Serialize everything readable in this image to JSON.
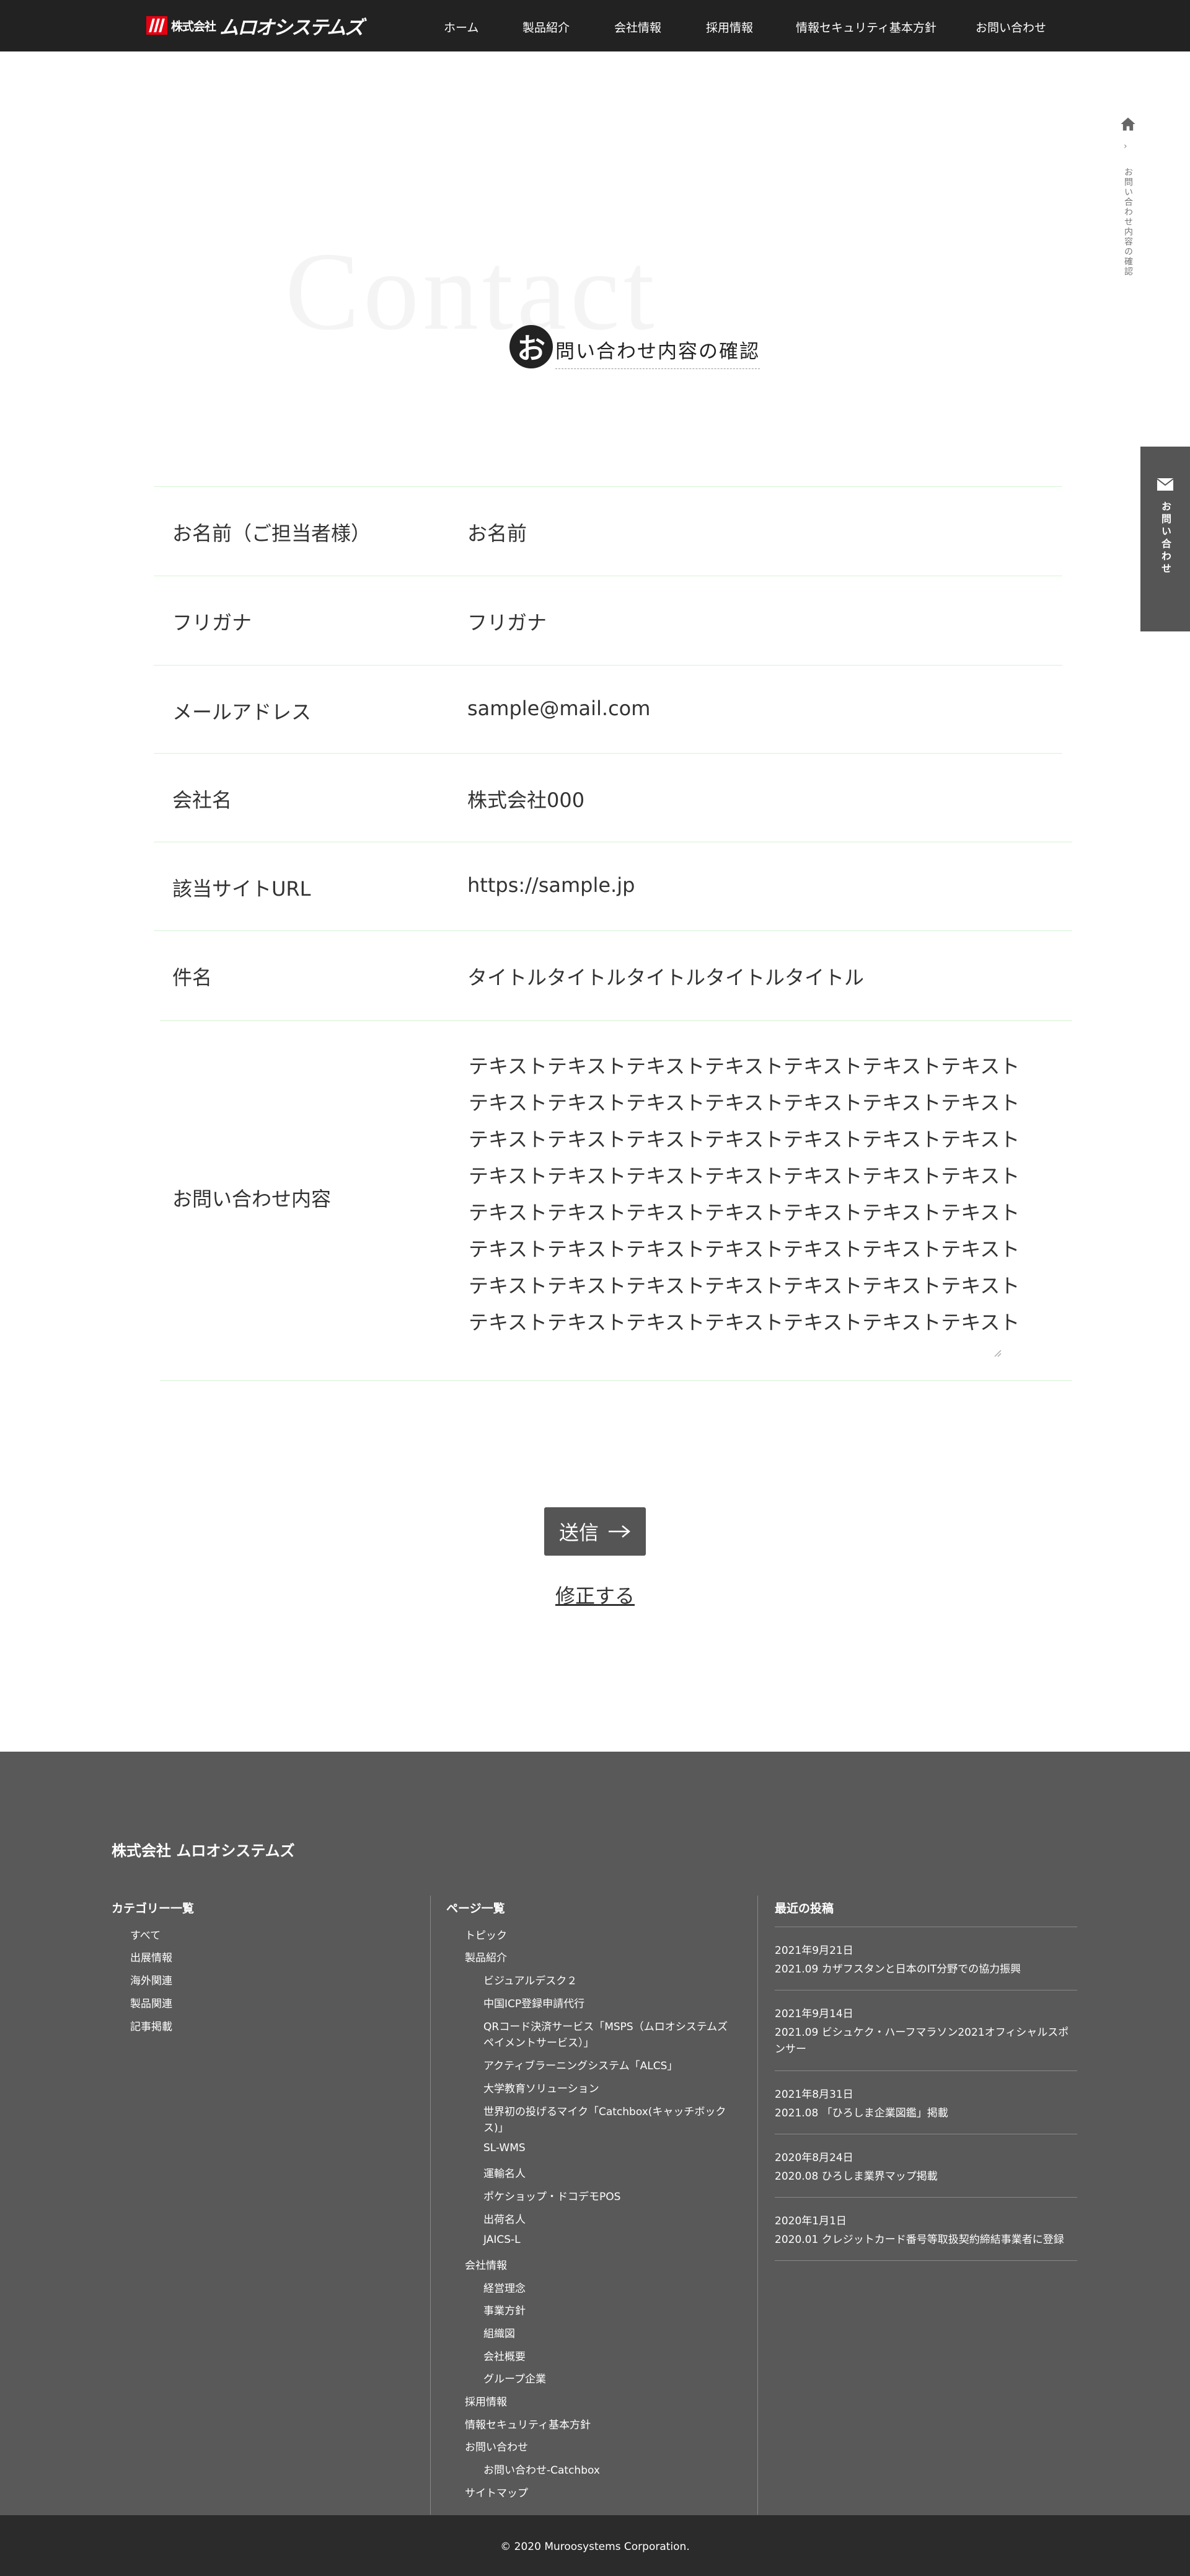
{
  "header": {
    "logo_small": "株式会社",
    "logo_big": "ムロオシステムズ",
    "nav": [
      "ホーム",
      "製品紹介",
      "会社情報",
      "採用情報",
      "情報セキュリティ基本方針",
      "お問い合わせ"
    ]
  },
  "breadcrumb": {
    "home_icon": "home-icon",
    "separator": "›",
    "current": "お問い合わせ内容の確認"
  },
  "side_contact": {
    "icon": "mail-icon",
    "label": "お問い合わせ"
  },
  "title": {
    "bg_word": "Contact",
    "circle_char": "お",
    "text": "問い合わせ内容の確認"
  },
  "form": {
    "rows": [
      {
        "label": "お名前（ご担当者様）",
        "value": "お名前"
      },
      {
        "label": "フリガナ",
        "value": "フリガナ"
      },
      {
        "label": "メールアドレス",
        "value": "sample@mail.com"
      },
      {
        "label": "会社名",
        "value": "株式会社000"
      },
      {
        "label": "該当サイトURL",
        "value": "https://sample.jp"
      },
      {
        "label": "件名",
        "value": "タイトルタイトルタイトルタイトルタイトル"
      }
    ],
    "message": {
      "label": "お問い合わせ内容",
      "lines": [
        "テキストテキストテキストテキストテキストテキストテキスト",
        "テキストテキストテキストテキストテキストテキストテキスト",
        "テキストテキストテキストテキストテキストテキストテキスト",
        "テキストテキストテキストテキストテキストテキストテキスト",
        "テキストテキストテキストテキストテキストテキストテキスト",
        "テキストテキストテキストテキストテキストテキストテキスト",
        "テキストテキストテキストテキストテキストテキストテキスト",
        "テキストテキストテキストテキストテキストテキストテキスト"
      ]
    }
  },
  "actions": {
    "submit_label": "送信",
    "fix_label": "修正する"
  },
  "footer": {
    "company": "株式会社 ムロオシステムズ",
    "categories": {
      "heading": "カテゴリー一覧",
      "items": [
        "すべて",
        "出展情報",
        "海外関連",
        "製品関連",
        "記事掲載"
      ]
    },
    "pages": {
      "heading": "ページ一覧",
      "items": [
        "トピック",
        "製品紹介",
        "ビジュアルデスク２",
        "中国ICP登録申請代行",
        "QRコード決済サービス「MSPS（ムロオシステムズ",
        "ペイメントサービス）」",
        "アクティブラーニングシステム「ALCS」",
        "大学教育ソリューション",
        "世界初の投げるマイク「Catchbox(キャッチボック",
        "ス)」",
        "SL-WMS",
        "運輸名人",
        "ポケショップ・ドコデモPOS",
        "出荷名人",
        "JAICS-L",
        "会社情報",
        "経営理念",
        "事業方針",
        "組織図",
        "会社概要",
        "グループ企業",
        "採用情報",
        "情報セキュリティ基本方針",
        "お問い合わせ",
        "お問い合わせ-Catchbox",
        "サイトマップ"
      ]
    },
    "posts": {
      "heading": "最近の投稿",
      "items": [
        {
          "date": "2021年9月21日",
          "title": "2021.09 カザフスタンと日本のIT分野での協力振興"
        },
        {
          "date": "2021年9月14日",
          "title": "2021.09 ビシュケク・ハーフマラソン2021オフィシャルスポンサー"
        },
        {
          "date": "2021年8月31日",
          "title": "2021.08 「ひろしま企業図鑑」掲載"
        },
        {
          "date": "2020年8月24日",
          "title": "2020.08 ひろしま業界マップ掲載"
        },
        {
          "date": "2020年1月1日",
          "title": "2020.01 クレジットカード番号等取扱契約締結事業者に登録"
        }
      ]
    },
    "copyright": "© 2020 Muroosystems Corporation."
  },
  "colors": {
    "header_bg": "#222222",
    "footer_bg": "#595959",
    "copyright_bg": "#2b2b2b",
    "button_bg": "#555555",
    "row_border": "#d6f3d6",
    "brand_red": "#e60012"
  }
}
